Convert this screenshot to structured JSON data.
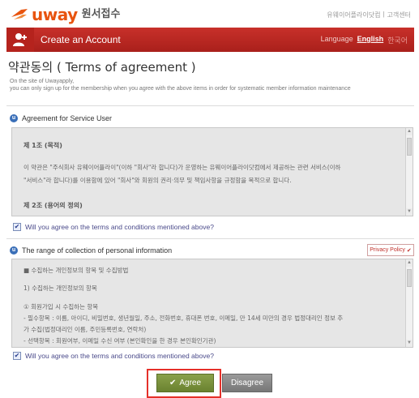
{
  "header": {
    "logo_text": "uway",
    "logo_sub": "원서접수",
    "top_links": [
      "유웨이어플라이닷컴",
      "|",
      "고객센터"
    ]
  },
  "titlebar": {
    "title": "Create an Account",
    "language_label": "Language",
    "language_selected": "English",
    "language_alt": "한국어"
  },
  "page": {
    "title": "약관동의 ( Terms of agreement )",
    "desc_line1": "On the site of Uwayapply,",
    "desc_line2": "you can only sign up for the membership when you agree with the above items in order for systematic member information maintenance"
  },
  "service_section": {
    "heading": "Agreement for Service User",
    "lines": [
      "제 1조 (목적)",
      "이 약관은 \"주식회사 유웨이어플라이\"(이하 \"회사\"라 합니다)가 운영하는 유웨이어플라이닷컴에서 제공하는 관련 서비스(이하",
      "\"서비스\"라 합니다)를 이용함에 있어 \"회사\"와 회원의 권리·의무 및 책임사항을 규정함을 목적으로 합니다.",
      "제 2조 (용어의 정의)"
    ],
    "agree_text": "Will you agree on the terms and conditions mentioned above?",
    "agree_checked": true
  },
  "privacy_section": {
    "heading": "The range of collection of personal information",
    "policy_button": "Privacy Policy",
    "lines": [
      "■ 수집하는 개인정보의 항목 및 수집방법",
      "1) 수집하는 개인정보의 항목",
      "① 회원가입 시 수집하는 항목",
      "- 필수항목 : 이름, 아이디, 비밀번호, 생년월일, 주소, 전화번호, 휴대폰 번호, 이메일, 만 14세 미만의 경우 법정대리인 정보 추",
      "가 수집(법정대리인 이름, 주민등록번호, 연락처)",
      "- 선택항목 : 회원여부, 이메일 수신 여부 (본인확인을 한 경우 본인확인기관)"
    ],
    "agree_text": "Will you agree on the terms and conditions mentioned above?",
    "agree_checked": true
  },
  "actions": {
    "agree_label": "Agree",
    "disagree_label": "Disagree"
  },
  "colors": {
    "brand_orange": "#e8540f",
    "title_red": "#b5231d",
    "agree_green": "#7a9240",
    "highlight_red": "#e5302a"
  }
}
